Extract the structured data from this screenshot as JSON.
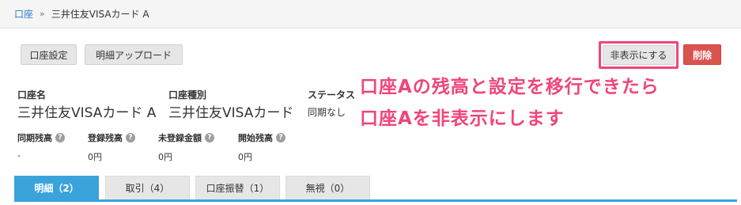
{
  "breadcrumb": {
    "root": "口座",
    "separator": "»",
    "current": "三井住友VISAカード A"
  },
  "toolbar": {
    "account_settings": "口座設定",
    "statement_upload": "明細アップロード",
    "hide": "非表示にする",
    "delete": "削除"
  },
  "account": {
    "name_label": "口座名",
    "name_value": "三井住友VISAカード A",
    "type_label": "口座種別",
    "type_value": "三井住友VISAカード",
    "status_label": "ステータス",
    "status_value": "同期なし"
  },
  "balances": [
    {
      "label": "同期残高",
      "value": "-"
    },
    {
      "label": "登録残高",
      "value": "0円"
    },
    {
      "label": "未登録金額",
      "value": "0円"
    },
    {
      "label": "開始残高",
      "value": "0円"
    }
  ],
  "annotation": {
    "line1": "口座Aの残高と設定を移行できたら",
    "line2": "口座Aを非表示にします"
  },
  "tabs": [
    {
      "label": "明細（2）",
      "active": true
    },
    {
      "label": "取引（4）",
      "active": false
    },
    {
      "label": "口座振替（1）",
      "active": false
    },
    {
      "label": "無視（0）",
      "active": false
    }
  ],
  "colors": {
    "accent": "#3ba3dc",
    "danger": "#d9534f",
    "annotation": "#f0457a",
    "link": "#2a7dc9"
  },
  "icons": {
    "help": "?"
  }
}
